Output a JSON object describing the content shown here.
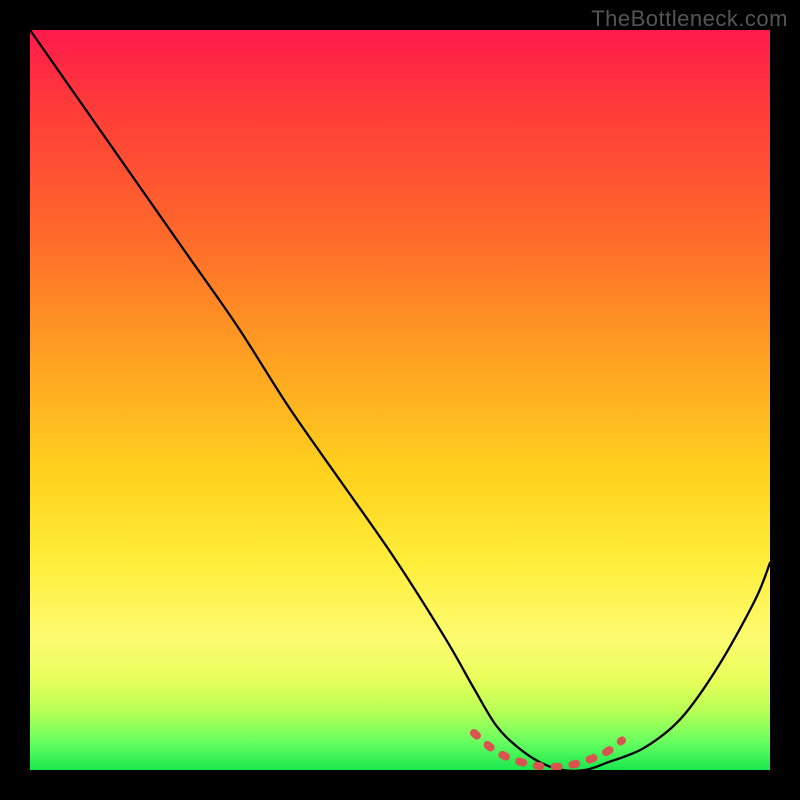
{
  "watermark": "TheBottleneck.com",
  "chart_data": {
    "type": "line",
    "title": "",
    "xlabel": "",
    "ylabel": "",
    "xlim": [
      0,
      100
    ],
    "ylim": [
      0,
      100
    ],
    "grid": false,
    "series": [
      {
        "name": "bottleneck-curve",
        "x": [
          0,
          7,
          14,
          21,
          28,
          35,
          42,
          49,
          56,
          60,
          63,
          66,
          69,
          72,
          75,
          78,
          83,
          88,
          93,
          98,
          100
        ],
        "values": [
          100,
          90,
          80,
          70,
          60,
          49,
          39,
          29,
          18,
          11,
          6,
          3,
          1,
          0,
          0,
          1,
          3,
          7,
          14,
          23,
          28
        ]
      },
      {
        "name": "sweet-spot-marker",
        "x": [
          60,
          63,
          66,
          69,
          72,
          75,
          78,
          80
        ],
        "values": [
          5,
          2.5,
          1.2,
          0.5,
          0.5,
          1.2,
          2.5,
          4
        ]
      }
    ],
    "gradient_stops": [
      {
        "pos": 0,
        "color": "#ff1a4b"
      },
      {
        "pos": 10,
        "color": "#ff3a3a"
      },
      {
        "pos": 28,
        "color": "#ff6a2a"
      },
      {
        "pos": 45,
        "color": "#ffa321"
      },
      {
        "pos": 60,
        "color": "#ffd21e"
      },
      {
        "pos": 72,
        "color": "#ffee3a"
      },
      {
        "pos": 82,
        "color": "#fdfb70"
      },
      {
        "pos": 88,
        "color": "#e7ff5a"
      },
      {
        "pos": 92,
        "color": "#b8ff55"
      },
      {
        "pos": 96,
        "color": "#6cff60"
      },
      {
        "pos": 100,
        "color": "#19e84e"
      }
    ],
    "colors": {
      "curve": "#000000",
      "marker": "#d9534f"
    }
  }
}
